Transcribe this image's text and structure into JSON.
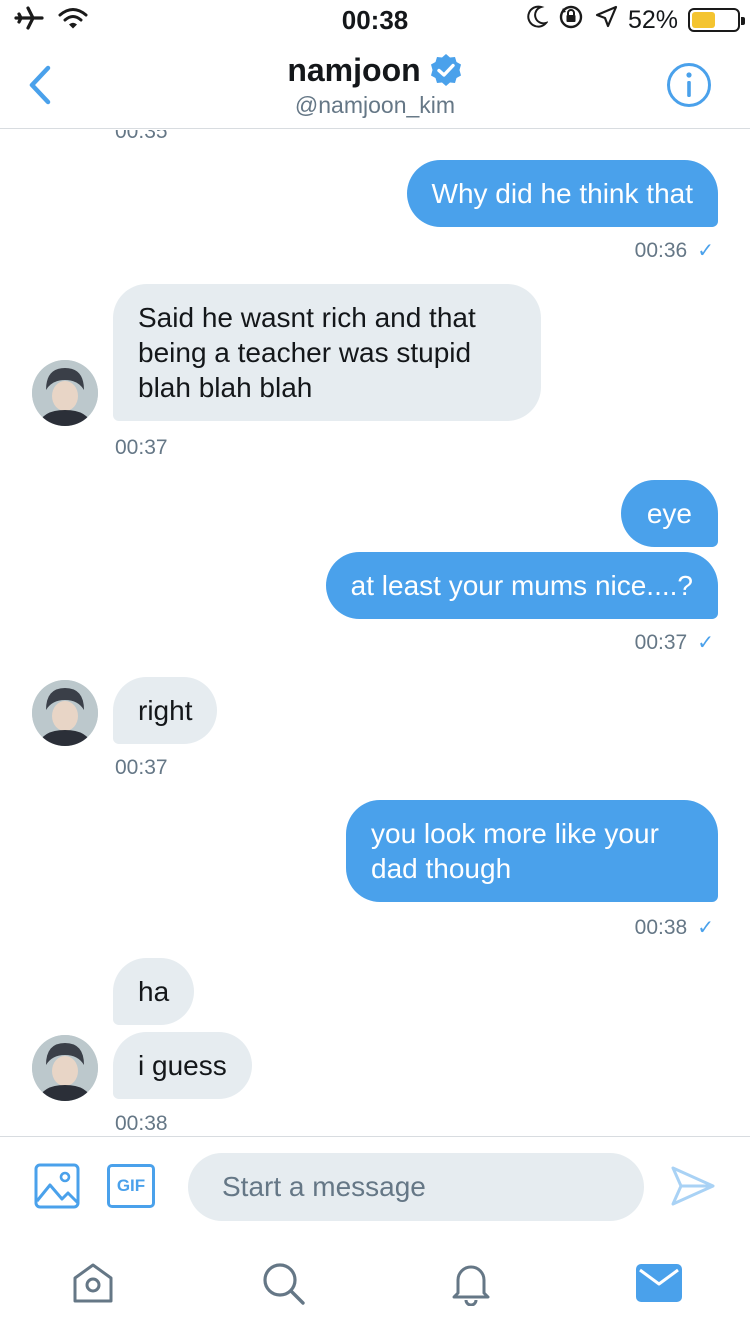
{
  "status_bar": {
    "time": "00:38",
    "battery_percent": "52%",
    "battery_level": 0.52,
    "icons": [
      "airplane-icon",
      "wifi-icon",
      "moon-icon",
      "rotation-lock-icon",
      "location-icon",
      "battery-icon"
    ]
  },
  "header": {
    "name": "namjoon",
    "handle": "@namjoon_kim",
    "verified": true,
    "icons": [
      "back-chevron-icon",
      "verified-badge-icon",
      "info-icon"
    ]
  },
  "conversation": {
    "cut_timestamp": "00:35",
    "messages": [
      {
        "direction": "outgoing",
        "text": "Why did he think that",
        "time": "00:36",
        "read": "✓"
      },
      {
        "direction": "incoming",
        "text": "Said he wasnt rich and that being a teacher was stupid blah blah blah",
        "time": "00:37"
      },
      {
        "direction": "outgoing",
        "text": "eye"
      },
      {
        "direction": "outgoing",
        "text": "at least your mums nice....?",
        "time": "00:37",
        "read": "✓"
      },
      {
        "direction": "incoming",
        "text": "right",
        "time": "00:37"
      },
      {
        "direction": "outgoing",
        "text": "you look more like your dad though",
        "time": "00:38",
        "read": "✓"
      },
      {
        "direction": "incoming",
        "text": "ha"
      },
      {
        "direction": "incoming",
        "text": "i guess",
        "time": "00:38"
      }
    ]
  },
  "composer": {
    "gif_label": "GIF",
    "placeholder": "Start a message",
    "value": "",
    "icons": [
      "image-icon",
      "gif-icon",
      "send-icon"
    ]
  },
  "tab_bar": {
    "tabs": [
      "home-icon",
      "search-icon",
      "notifications-icon",
      "messages-icon"
    ],
    "active": "messages-icon"
  },
  "colors": {
    "accent": "#4aa1eb",
    "incoming_bubble": "#e6ecf0",
    "muted_text": "#657786",
    "battery_fill": "#f4c430"
  }
}
